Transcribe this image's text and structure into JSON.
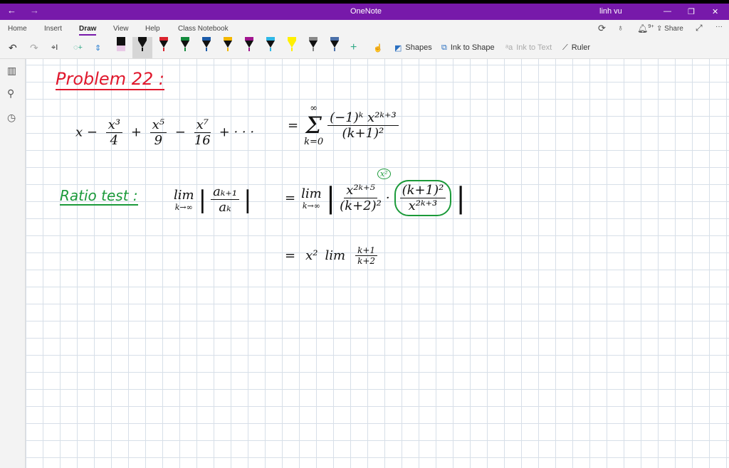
{
  "titlebar": {
    "title": "OneNote",
    "user": "linh vu",
    "back": "←",
    "forward": "→",
    "minimize": "—",
    "restore": "❐",
    "close": "✕"
  },
  "ribbon": {
    "tabs": [
      {
        "label": "Home"
      },
      {
        "label": "Insert"
      },
      {
        "label": "Draw",
        "active": true
      },
      {
        "label": "View"
      },
      {
        "label": "Help"
      },
      {
        "label": "Class Notebook"
      }
    ],
    "share": "Share",
    "notif_badge": "9+",
    "tools": {
      "shapes": "Shapes",
      "ink_to_shape": "Ink to Shape",
      "ink_to_text": "Ink to Text",
      "ruler": "Ruler"
    },
    "pens": [
      {
        "color": "#e8c9e6",
        "type": "eraser"
      },
      {
        "color": "#111111",
        "selected": true
      },
      {
        "color": "#d9232e"
      },
      {
        "color": "#138a3c"
      },
      {
        "color": "#1a5aa8"
      },
      {
        "color": "#f2b600"
      },
      {
        "color": "#a0158f"
      },
      {
        "color": "#2fb7e6"
      },
      {
        "color": "#fff000",
        "type": "highlighter"
      },
      {
        "color": "#888888"
      },
      {
        "color": "#4a6fa8"
      }
    ]
  },
  "page": {
    "heading": "Problem 22 :",
    "series_lhs": [
      "x −",
      "x³",
      "4",
      "+",
      "x⁵",
      "9",
      "−",
      "x⁷",
      "16",
      "+ · · ·"
    ],
    "series_rhs": {
      "eq": "=",
      "sigma": "Σ",
      "upper": "∞",
      "lower": "k=0",
      "num": "(−1)ᵏ x²ᵏ⁺³",
      "den": "(k+1)²"
    },
    "ratio_label": "Ratio test :",
    "ratio_lhs": {
      "lim": "lim",
      "sub": "k→∞",
      "num": "aₖ₊₁",
      "den": "aₖ"
    },
    "ratio_rhs": {
      "eq": "=",
      "lim": "lim",
      "sub": "k→∞",
      "num1": "x²ᵏ⁺⁵",
      "den1": "(k+2)²",
      "dot": "·",
      "num2": "(k+1)²",
      "den2": "x²ᵏ⁺³",
      "note": "x²"
    },
    "result": {
      "eq": "=",
      "x2": "x²",
      "lim": "lim",
      "num": "k+1",
      "den": "k+2"
    }
  },
  "colors": {
    "accent": "#7719aa",
    "ink_red": "#e0182d",
    "ink_green": "#1b9a3a"
  }
}
